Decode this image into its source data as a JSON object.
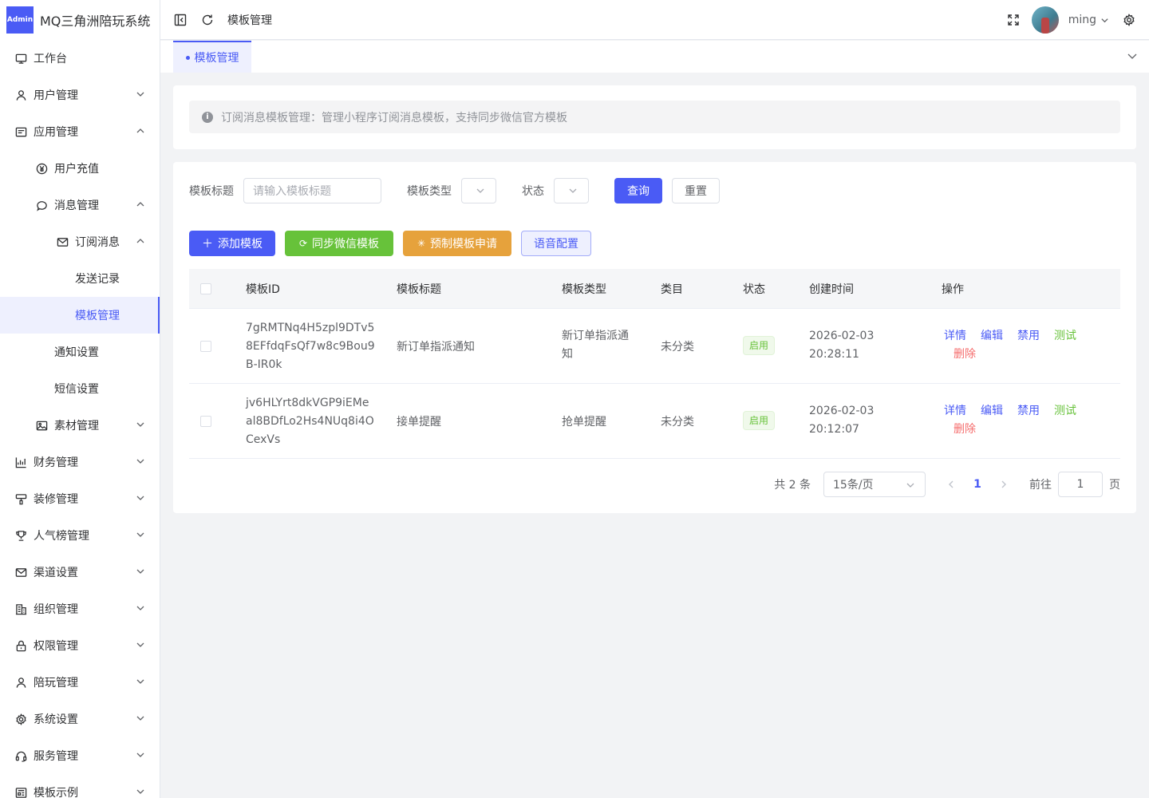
{
  "app": {
    "logo_badge": "Admin",
    "title": "MQ三角洲陪玩系统"
  },
  "sidebar": {
    "items": [
      {
        "label": "工作台",
        "icon": "monitor-icon"
      },
      {
        "label": "用户管理",
        "icon": "user-icon"
      },
      {
        "label": "应用管理",
        "icon": "app-icon"
      },
      {
        "label": "用户充值",
        "icon": "yen-icon"
      },
      {
        "label": "消息管理",
        "icon": "chat-icon"
      },
      {
        "label": "订阅消息",
        "icon": "mail-icon"
      },
      {
        "label": "发送记录"
      },
      {
        "label": "模板管理"
      },
      {
        "label": "通知设置"
      },
      {
        "label": "短信设置"
      },
      {
        "label": "素材管理",
        "icon": "image-icon"
      },
      {
        "label": "财务管理",
        "icon": "chart-icon"
      },
      {
        "label": "装修管理",
        "icon": "brush-icon"
      },
      {
        "label": "人气榜管理",
        "icon": "trophy-icon"
      },
      {
        "label": "渠道设置",
        "icon": "mail-icon"
      },
      {
        "label": "组织管理",
        "icon": "building-icon"
      },
      {
        "label": "权限管理",
        "icon": "lock-icon"
      },
      {
        "label": "陪玩管理",
        "icon": "user-icon"
      },
      {
        "label": "系统设置",
        "icon": "gear-icon"
      },
      {
        "label": "服务管理",
        "icon": "headset-icon"
      },
      {
        "label": "模板示例",
        "icon": "template-icon"
      }
    ]
  },
  "header": {
    "breadcrumb": "模板管理",
    "username": "ming"
  },
  "tabs": [
    {
      "label": "模板管理"
    }
  ],
  "alert": {
    "text": "订阅消息模板管理：管理小程序订阅消息模板，支持同步微信官方模板"
  },
  "filters": {
    "title_label": "模板标题",
    "title_placeholder": "请输入模板标题",
    "type_label": "模板类型",
    "status_label": "状态",
    "query_button": "查询",
    "reset_button": "重置"
  },
  "actions": {
    "add": "添加模板",
    "sync": "同步微信模板",
    "preset": "预制模板申请",
    "voice": "语音配置"
  },
  "table": {
    "columns": [
      "模板ID",
      "模板标题",
      "模板类型",
      "类目",
      "状态",
      "创建时间",
      "操作"
    ],
    "rows": [
      {
        "id_lines": [
          "7gRMTNq4H5zpl9DTv5",
          "8EFfdqFsQf7w8c9Bou9",
          "B-IR0k"
        ],
        "title": "新订单指派通知",
        "type_lines": [
          "新订单指派通",
          "知"
        ],
        "category": "未分类",
        "status": "启用",
        "date": "2026-02-03",
        "time": "20:28:11"
      },
      {
        "id_lines": [
          "jv6HLYrt8dkVGP9iEMe",
          "al8BDfLo2Hs4NUq8i4O",
          "CexVs"
        ],
        "title": "接单提醒",
        "type_lines": [
          "抢单提醒"
        ],
        "category": "未分类",
        "status": "启用",
        "date": "2026-02-03",
        "time": "20:12:07"
      }
    ],
    "ops": {
      "detail": "详情",
      "edit": "编辑",
      "disable": "禁用",
      "test": "测试",
      "delete": "删除"
    }
  },
  "pagination": {
    "total": "共 2 条",
    "page_size": "15条/页",
    "current": "1",
    "goto_label": "前往",
    "goto_value": "1",
    "page_unit": "页"
  }
}
